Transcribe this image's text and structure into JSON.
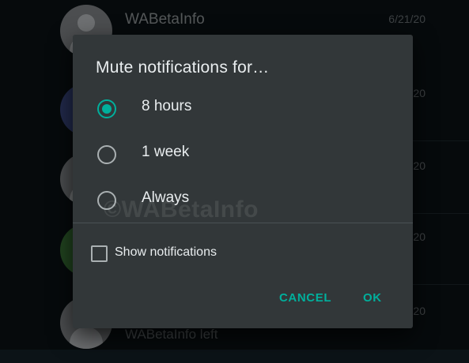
{
  "chat_list": {
    "rows": [
      {
        "name": "WABetaInfo",
        "date": "6/21/20",
        "subtitle": ""
      },
      {
        "name": "",
        "date": "20",
        "subtitle": ""
      },
      {
        "name": "",
        "date": "20",
        "subtitle": ""
      },
      {
        "name": "",
        "date": "20",
        "subtitle": ""
      },
      {
        "name": "",
        "date": "20",
        "subtitle": "WABetaInfo left"
      }
    ]
  },
  "dialog": {
    "title": "Mute notifications for…",
    "options": [
      {
        "label": "8 hours",
        "selected": true
      },
      {
        "label": "1 week",
        "selected": false
      },
      {
        "label": "Always",
        "selected": false
      }
    ],
    "show_notifications": {
      "label": "Show notifications",
      "checked": false
    },
    "cancel_label": "CANCEL",
    "ok_label": "OK"
  },
  "watermark": "©WABetaInfo",
  "colors": {
    "accent": "#00af9c",
    "dialog_bg": "#323739",
    "app_bg": "#0c1317",
    "text_primary": "#e9edef"
  }
}
